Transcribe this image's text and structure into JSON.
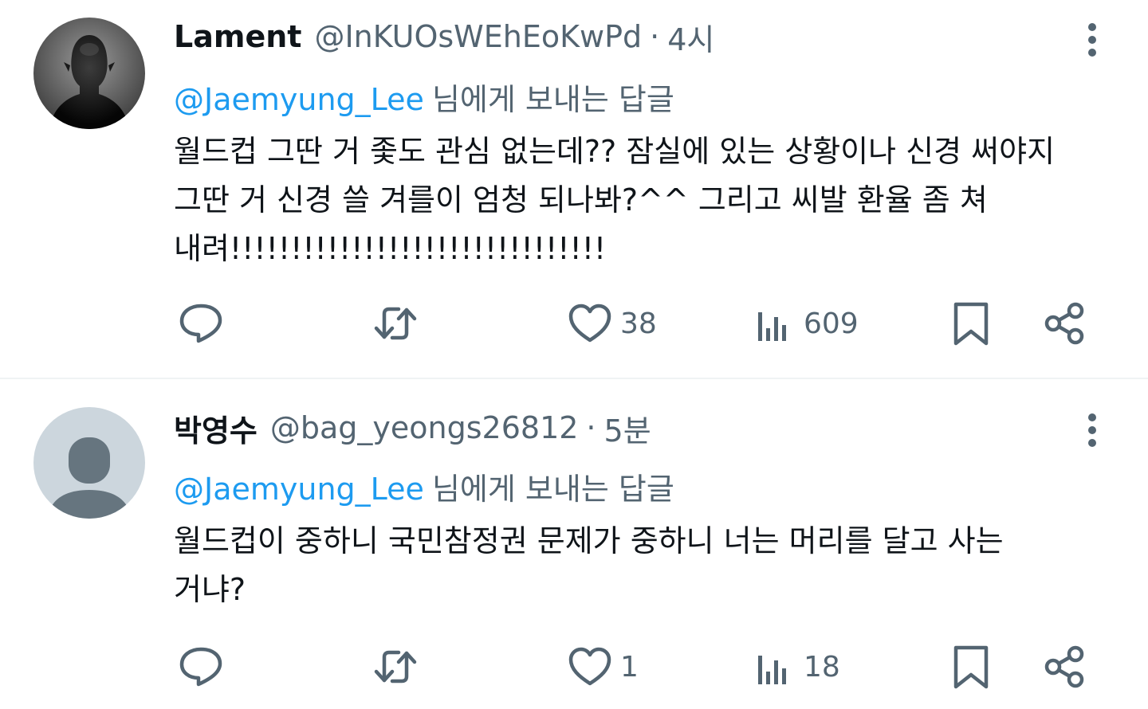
{
  "tweets": [
    {
      "display_name": "Lament",
      "handle": "@InKUOsWEhEoKwPd",
      "separator": "·",
      "time": "4시",
      "avatar": "photo-avatar",
      "reply_mention": "@Jaemyung_Lee",
      "reply_suffix": "님에게 보내는 답글",
      "text_lines": [
        "월드컵 그딴 거 좇도 관심 없는데?? 잠실에 있는 상황이나 신경 써야지",
        "그딴 거 신경 쓸 겨를이 엄청 되나봐?^^ 그리고 씨발 환율 좀 쳐",
        "내려!!!!!!!!!!!!!!!!!!!!!!!!!!!!!!!"
      ],
      "actions": {
        "reply": "",
        "retweet": "",
        "like": "38",
        "views": "609"
      }
    },
    {
      "display_name": "박영수",
      "handle": "@bag_yeongs26812",
      "separator": "·",
      "time": "5분",
      "avatar": "default-avatar",
      "reply_mention": "@Jaemyung_Lee",
      "reply_suffix": "님에게 보내는 답글",
      "text_lines": [
        "월드컵이 중하니 국민참정권 문제가 중하니 너는 머리를 달고 사는",
        "거냐?"
      ],
      "actions": {
        "reply": "",
        "retweet": "",
        "like": "1",
        "views": "18"
      }
    }
  ],
  "icons": {
    "reply": "speech-bubble-icon",
    "retweet": "retweet-arrows-icon",
    "like": "heart-icon",
    "views": "bar-chart-icon",
    "bookmark": "bookmark-icon",
    "share": "share-nodes-icon",
    "more": "vertical-ellipsis-icon"
  },
  "colors": {
    "text": "#0f1419",
    "secondary": "#536471",
    "accent": "#1d9bf0",
    "divider": "#eff3f4",
    "default_avatar_bg": "#ccd6dd",
    "default_avatar_fg": "#66757f"
  }
}
